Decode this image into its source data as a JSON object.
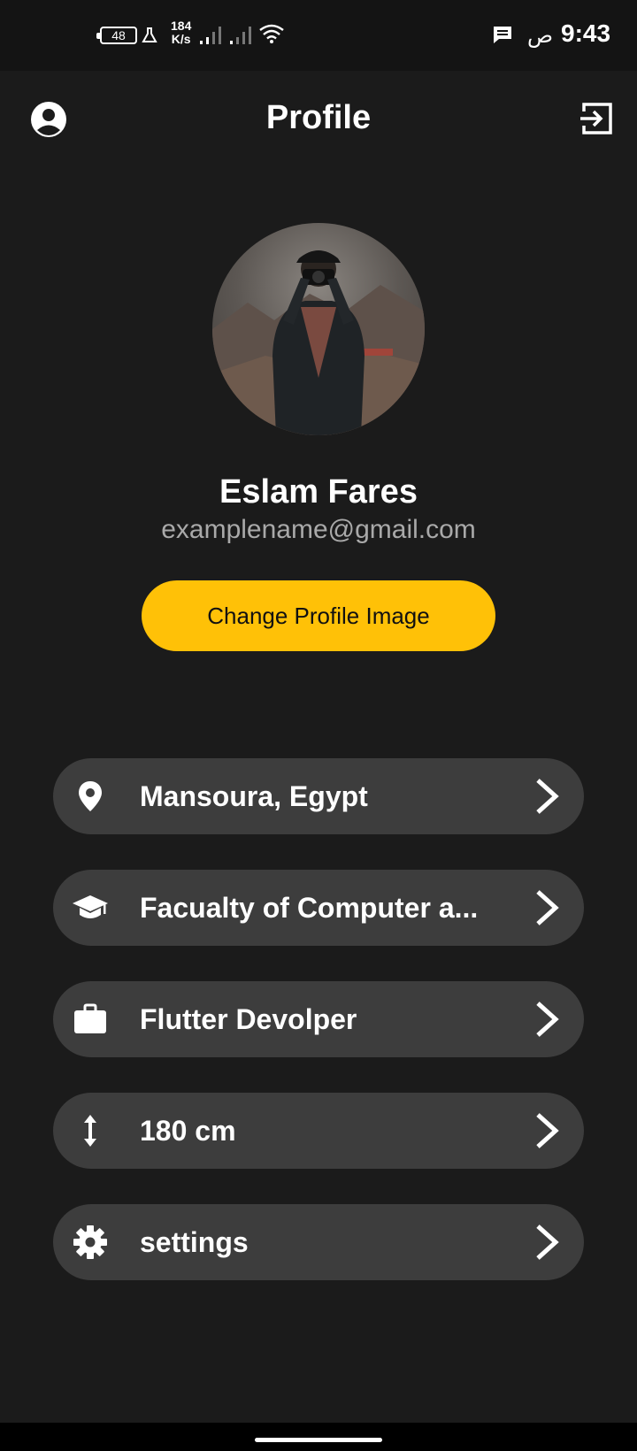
{
  "status_bar": {
    "battery_level": "48",
    "net_speed_value": "184",
    "net_speed_unit": "K/s",
    "ampm": "ص",
    "time": "9:43"
  },
  "app_bar": {
    "title": "Profile",
    "left_icon": "account-circle-icon",
    "right_icon": "logout-icon"
  },
  "profile": {
    "name": "Eslam Fares",
    "email": "examplename@gmail.com",
    "change_image_label": "Change Profile Image"
  },
  "list": [
    {
      "icon": "location-pin-icon",
      "label": "Mansoura, Egypt"
    },
    {
      "icon": "graduation-cap-icon",
      "label": "Facualty of Computer a..."
    },
    {
      "icon": "briefcase-icon",
      "label": "Flutter Devolper"
    },
    {
      "icon": "height-arrows-icon",
      "label": "180 cm"
    },
    {
      "icon": "gear-icon",
      "label": "settings"
    }
  ],
  "colors": {
    "background": "#1b1b1b",
    "tile": "#3d3d3d",
    "accent": "#ffc107",
    "email_text": "#a9a9a9"
  }
}
